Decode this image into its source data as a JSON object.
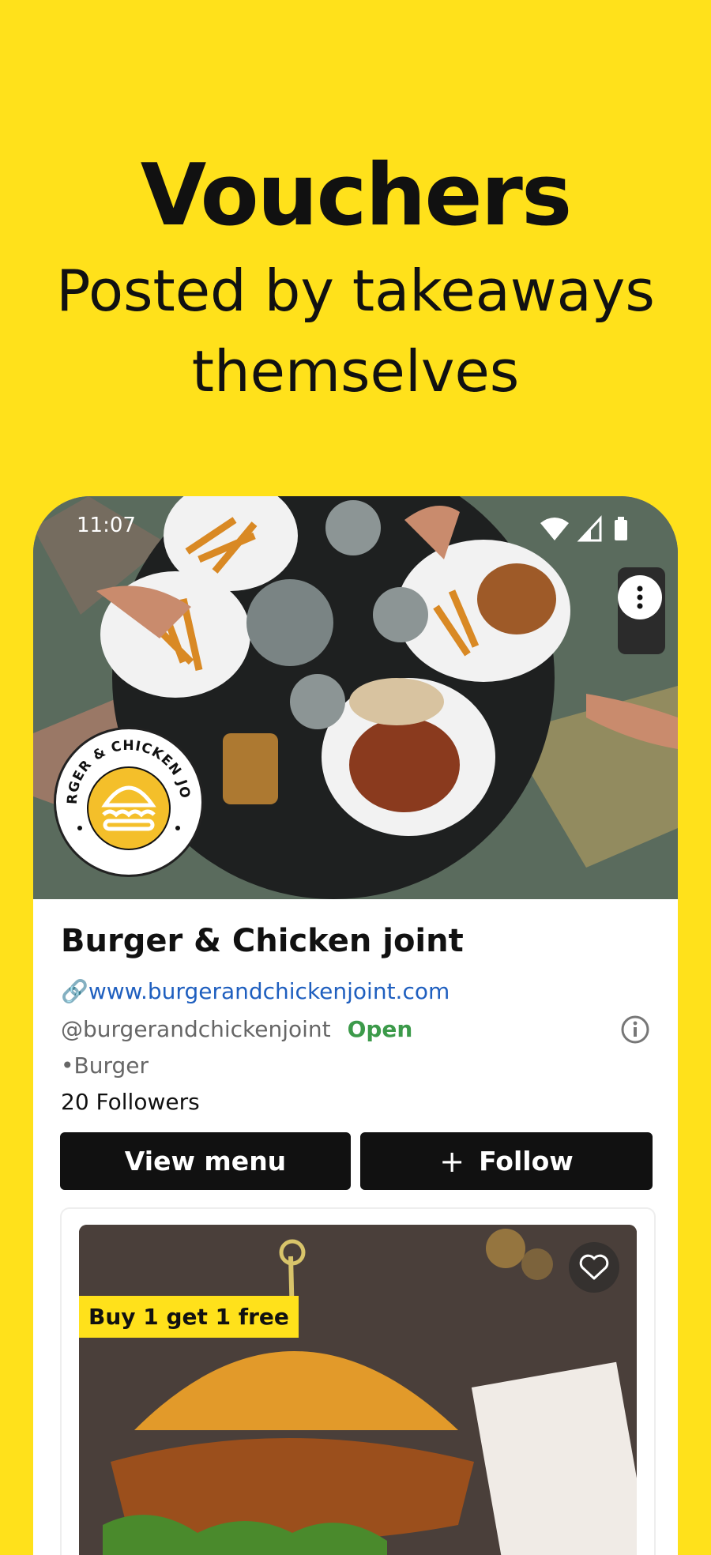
{
  "hero": {
    "title": "Vouchers",
    "subtitle_line1": "Posted by takeaways",
    "subtitle_line2": "themselves"
  },
  "status_bar": {
    "time": "11:07",
    "icons": [
      "wifi-icon",
      "signal-icon",
      "battery-icon"
    ]
  },
  "restaurant": {
    "name": "Burger & Chicken joint",
    "website": "www.burgerandchickenjoint.com",
    "handle": "@burgerandchickenjoint",
    "status": "Open",
    "category": "•Burger",
    "followers": "20 Followers",
    "logo_text": "BURGER & CHICKEN JOINT"
  },
  "actions": {
    "view_menu": "View menu",
    "follow": "Follow",
    "follow_icon": "plus-icon"
  },
  "voucher": {
    "label": "Buy 1 get 1 free",
    "favorite_icon": "heart-icon"
  },
  "colors": {
    "brand_yellow": "#FFE11B",
    "button_dark": "#111111",
    "link_blue": "#1f5fbf",
    "open_green": "#3c9a4a"
  }
}
